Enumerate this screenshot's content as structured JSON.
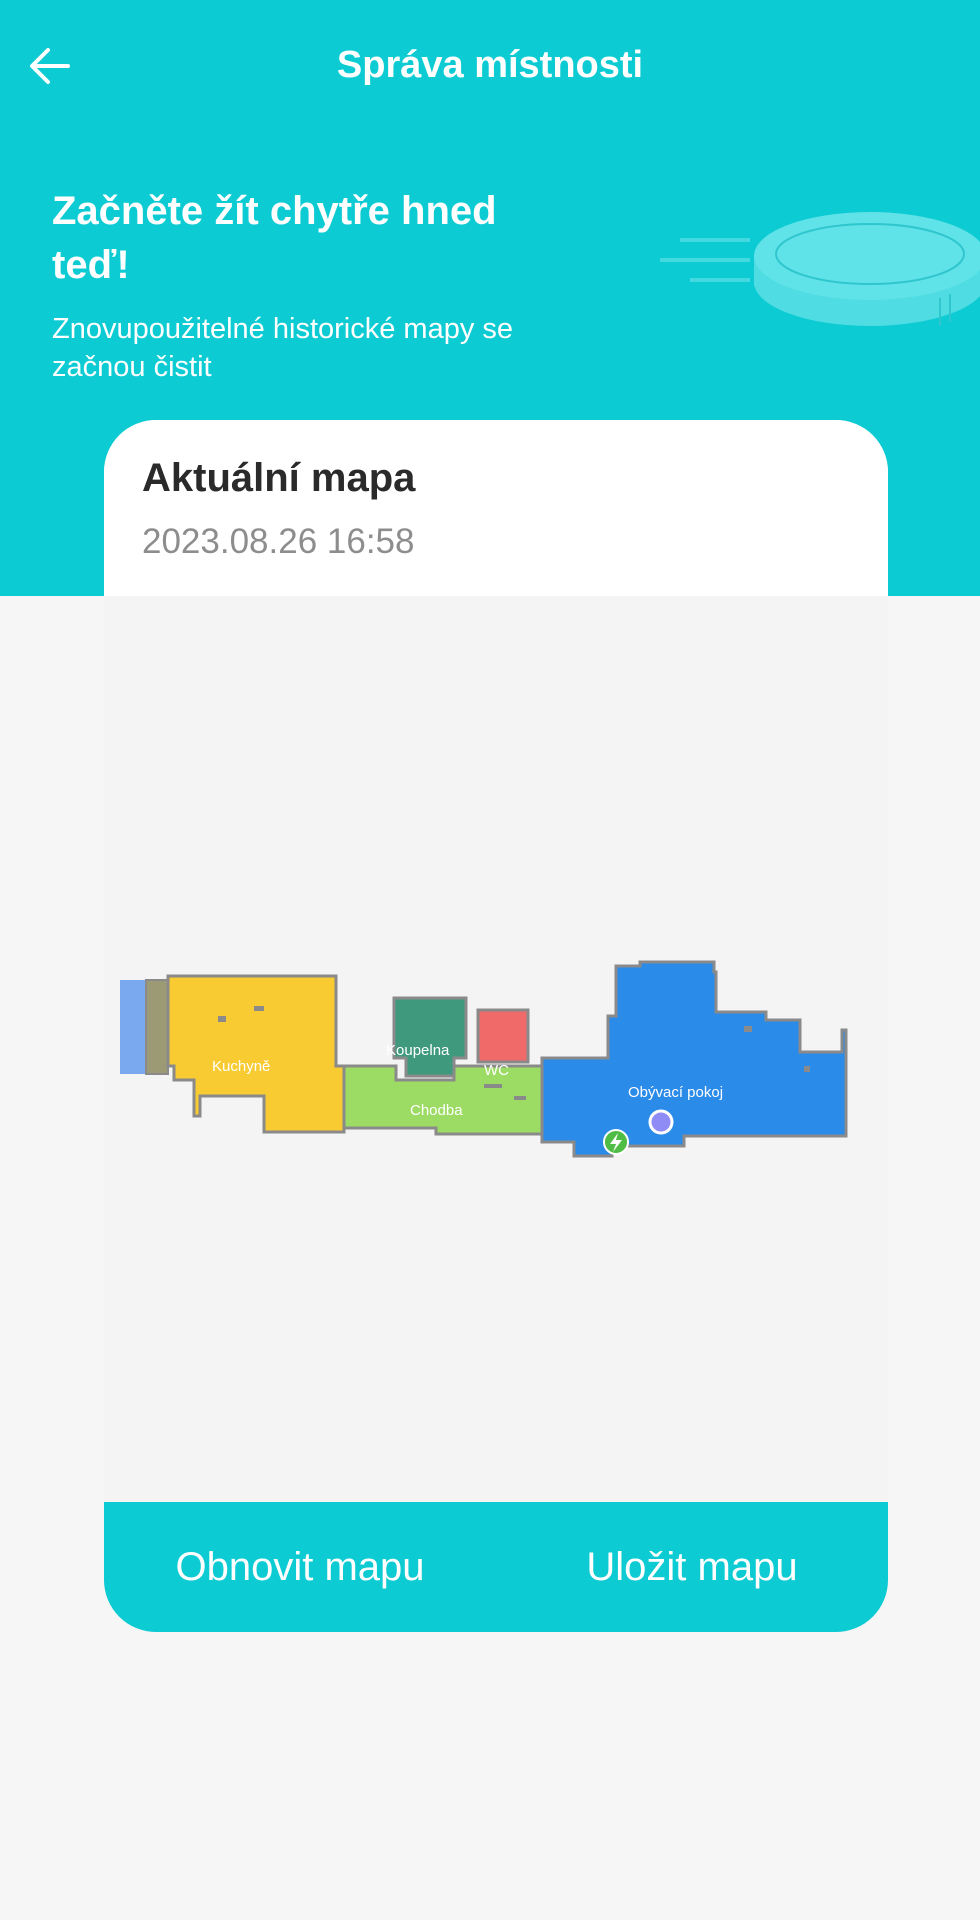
{
  "header": {
    "title": "Správa místnosti",
    "back_icon": "arrow-left-icon"
  },
  "promo": {
    "heading": "Začněte žít chytře hned teď!",
    "subtitle": "Znovupoužitelné historické mapy se začnou čistit",
    "illustration_icon": "robot-vacuum-icon"
  },
  "map_card": {
    "title": "Aktuální mapa",
    "date": "2023.08.26 16:58",
    "rooms": {
      "kitchen": "Kuchyně",
      "bathroom": "Koupelna",
      "wc": "WC",
      "hallway": "Chodba",
      "living_room": "Obývací pokoj"
    },
    "robot_icon": "robot-position-icon",
    "dock_icon": "charging-dock-icon"
  },
  "actions": {
    "refresh_label": "Obnovit mapu",
    "save_label": "Uložit mapu"
  },
  "colors": {
    "accent": "#0ccbd3",
    "kitchen": "#f8cb32",
    "bathroom": "#3f9a7d",
    "wc": "#f06a6a",
    "hallway": "#9ddc64",
    "living_room": "#2a8be8",
    "background": "#f6f6f6"
  }
}
